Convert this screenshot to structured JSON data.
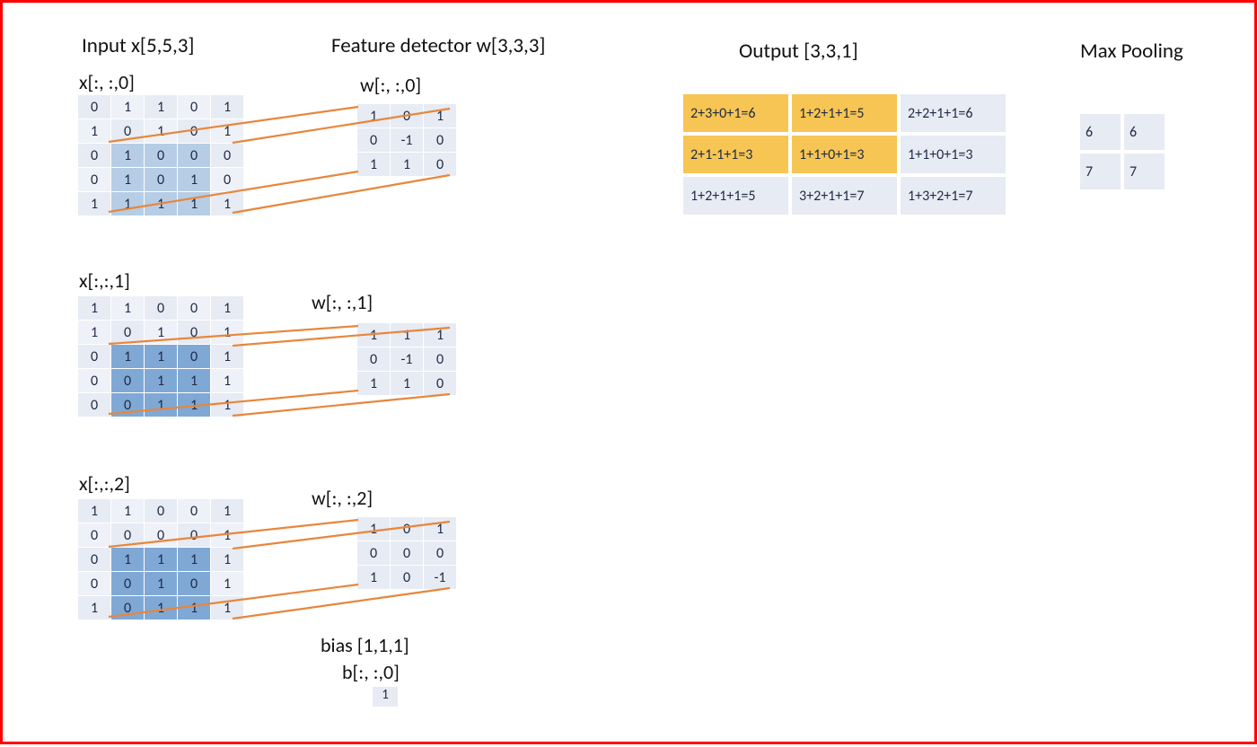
{
  "headings": {
    "input_title": "Input  x[5,5,3]",
    "feature_title": "Feature detector w[3,3,3]",
    "output_title": "Output [3,3,1]",
    "maxpool_title": "Max Pooling",
    "x0_label": "x[:, :,0]",
    "x1_label": "x[:,:,1]",
    "x2_label": "x[:,:,2]",
    "w0_label": "w[:, :,0]",
    "w1_label": "w[:, :,1]",
    "w2_label": "w[:, :,2]",
    "bias_label1": "bias [1,1,1]",
    "bias_label2": "b[:, :,0]"
  },
  "x0": [
    [
      0,
      1,
      1,
      0,
      1
    ],
    [
      1,
      0,
      1,
      0,
      1
    ],
    [
      0,
      1,
      0,
      0,
      0
    ],
    [
      0,
      1,
      0,
      1,
      0
    ],
    [
      1,
      1,
      1,
      1,
      1
    ]
  ],
  "x1": [
    [
      1,
      1,
      0,
      0,
      1
    ],
    [
      1,
      0,
      1,
      0,
      1
    ],
    [
      0,
      1,
      1,
      0,
      1
    ],
    [
      0,
      0,
      1,
      1,
      1
    ],
    [
      0,
      0,
      1,
      1,
      1
    ]
  ],
  "x2": [
    [
      1,
      1,
      0,
      0,
      1
    ],
    [
      0,
      0,
      0,
      0,
      1
    ],
    [
      0,
      1,
      1,
      1,
      1
    ],
    [
      0,
      0,
      1,
      0,
      1
    ],
    [
      1,
      0,
      1,
      1,
      1
    ]
  ],
  "w0": [
    [
      1,
      0,
      1
    ],
    [
      0,
      -1,
      0
    ],
    [
      1,
      1,
      0
    ]
  ],
  "w1": [
    [
      1,
      1,
      1
    ],
    [
      0,
      -1,
      0
    ],
    [
      1,
      1,
      0
    ]
  ],
  "w2": [
    [
      1,
      0,
      1
    ],
    [
      0,
      0,
      0
    ],
    [
      1,
      0,
      -1
    ]
  ],
  "bias_value": "1",
  "output": {
    "cells": [
      [
        "2+3+0+1=6",
        "1+2+1+1=5",
        "2+2+1+1=6"
      ],
      [
        "2+1-1+1=3",
        "1+1+0+1=3",
        "1+1+0+1=3"
      ],
      [
        "1+2+1+1=5",
        "3+2+1+1=7",
        "1+3+2+1=7"
      ]
    ],
    "highlight": [
      [
        true,
        true,
        false
      ],
      [
        true,
        true,
        false
      ],
      [
        false,
        false,
        false
      ]
    ]
  },
  "maxpool": [
    [
      6,
      6
    ],
    [
      7,
      7
    ]
  ],
  "hl": {
    "x0": {
      "rows": [
        2,
        3,
        4
      ],
      "cols": [
        1,
        2,
        3
      ]
    },
    "x1": {
      "rows": [
        2,
        3,
        4
      ],
      "cols": [
        1,
        2,
        3
      ]
    },
    "x2": {
      "rows": [
        2,
        3,
        4
      ],
      "cols": [
        1,
        2,
        3
      ]
    }
  }
}
